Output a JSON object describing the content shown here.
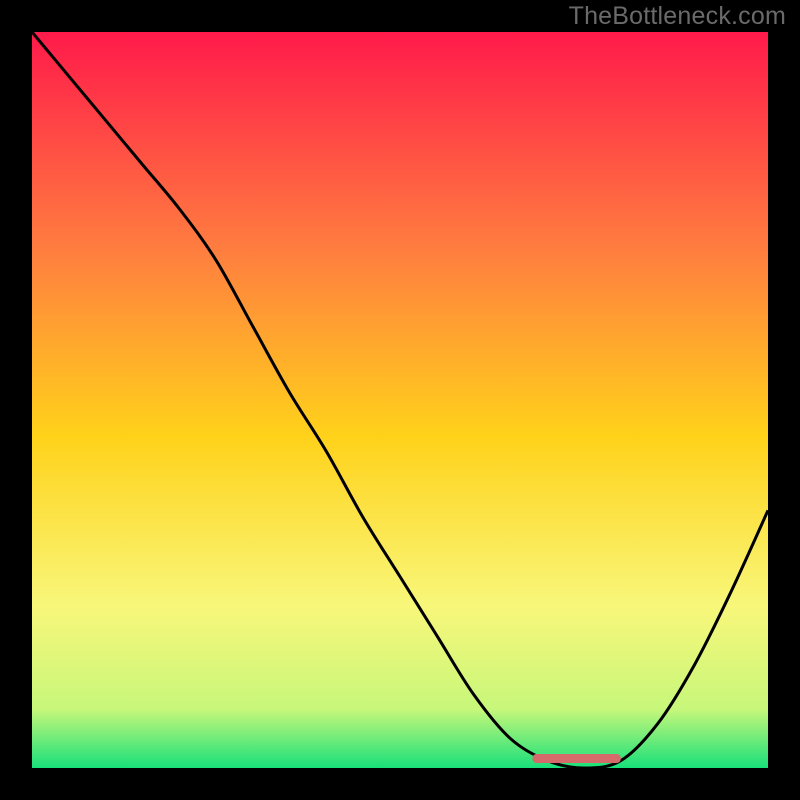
{
  "watermark": "TheBottleneck.com",
  "chart_data": {
    "type": "line",
    "title": "",
    "xlabel": "",
    "ylabel": "",
    "xlim": [
      0,
      100
    ],
    "ylim": [
      0,
      100
    ],
    "x": [
      0,
      5,
      10,
      15,
      20,
      25,
      30,
      35,
      40,
      45,
      50,
      55,
      60,
      65,
      70,
      75,
      80,
      85,
      90,
      95,
      100
    ],
    "values": [
      100,
      94,
      88,
      82,
      76,
      69,
      60,
      51,
      43,
      34,
      26,
      18,
      10,
      4,
      1,
      0,
      1,
      6,
      14,
      24,
      35
    ],
    "optimal_range_x": [
      68,
      80
    ],
    "optimal_marker_color": "#d46a6a",
    "background_gradient": {
      "top": "#ff1a4a",
      "mid_upper": "#ff7f3f",
      "mid": "#ffd21a",
      "mid_lower": "#f8f77a",
      "near_bottom": "#c7f77a",
      "bottom": "#18e07a"
    },
    "curve_color": "#000000",
    "frame_color": "#000000"
  }
}
